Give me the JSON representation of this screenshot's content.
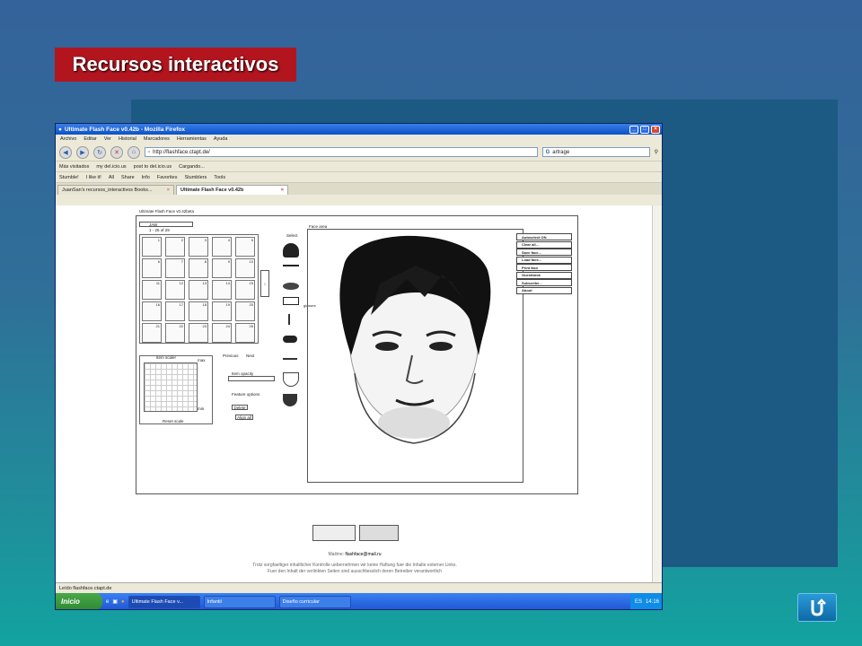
{
  "slide": {
    "title": "Recursos interactivos"
  },
  "browser": {
    "window_title": "Ultimate Flash Face v0.42b - Mozilla Firefox",
    "menu": [
      "Archivo",
      "Editar",
      "Ver",
      "Historial",
      "Marcadores",
      "Herramientas",
      "Ayuda"
    ],
    "url": "http://flashface.ctapt.de/",
    "search_value": "artrage",
    "bookmarks": [
      "Más visitados",
      "my del.icio.us",
      "post to del.icio.us",
      "Cargando..."
    ],
    "toolbar2": [
      "Stumble!",
      "I like it!",
      "All",
      "Share",
      "Info",
      "Favorites",
      "Stumblers",
      "Tools"
    ],
    "tabs": [
      "JuanSan's recursos_interactivos Books...",
      "Ultimate Flash Face v0.42b"
    ],
    "status": "Leído flashface.ctapt.de"
  },
  "app": {
    "header": "Ultimate Flash Face v0.42beta",
    "selector_text": "JAW",
    "page_indicator": "1 - 25 of 29",
    "select_label": "Select",
    "face_area_label": "Face area",
    "glasses_label": "glasses",
    "thumb_numbers": [
      "1",
      "2",
      "3",
      "4",
      "5",
      "6",
      "7",
      "8",
      "9",
      "10",
      "11",
      "12",
      "13",
      "14",
      "15",
      "16",
      "17",
      "18",
      "19",
      "20",
      "21",
      "22",
      "23",
      "24",
      "25"
    ],
    "previous_label": "Previous",
    "next_label": "Next",
    "item_scaler_label": "Item scaler",
    "max_label": "max",
    "min_label": "min",
    "reset_scale_label": "Reset scale",
    "item_opacity_label": "Item opacity",
    "feature_options_label": "Feature options",
    "delete_label": "Delete",
    "align_label": "Align all",
    "menu_items": [
      "Autoselect ON",
      "Clear all...",
      "Save face...",
      "Load face...",
      "Print face",
      "Guestbook",
      "Subscribe...",
      "About"
    ],
    "mail_prefix": "Mailme:",
    "mail": "flashface@mail.ru",
    "disclaimer_1": "Trotz sorgfaeltiger inhaltlicher Kontrolle uebernehmen wir keine Haftung fuer die Inhalte externer Links.",
    "disclaimer_2": "Fuer den Inhalt der verlinkten Seiten sind ausschliesslich deren Betreiber verantwortlich"
  },
  "taskbar": {
    "start_label": "Inicio",
    "tasks": [
      "Ultimate Flash Face v...",
      "Infantil",
      "Diseño curricular"
    ],
    "lang": "ES",
    "clock": "14:16"
  },
  "colors": {
    "title_bg": "#b3151f",
    "panel": "#1c5a83",
    "xp_blue": "#0a52c9"
  }
}
